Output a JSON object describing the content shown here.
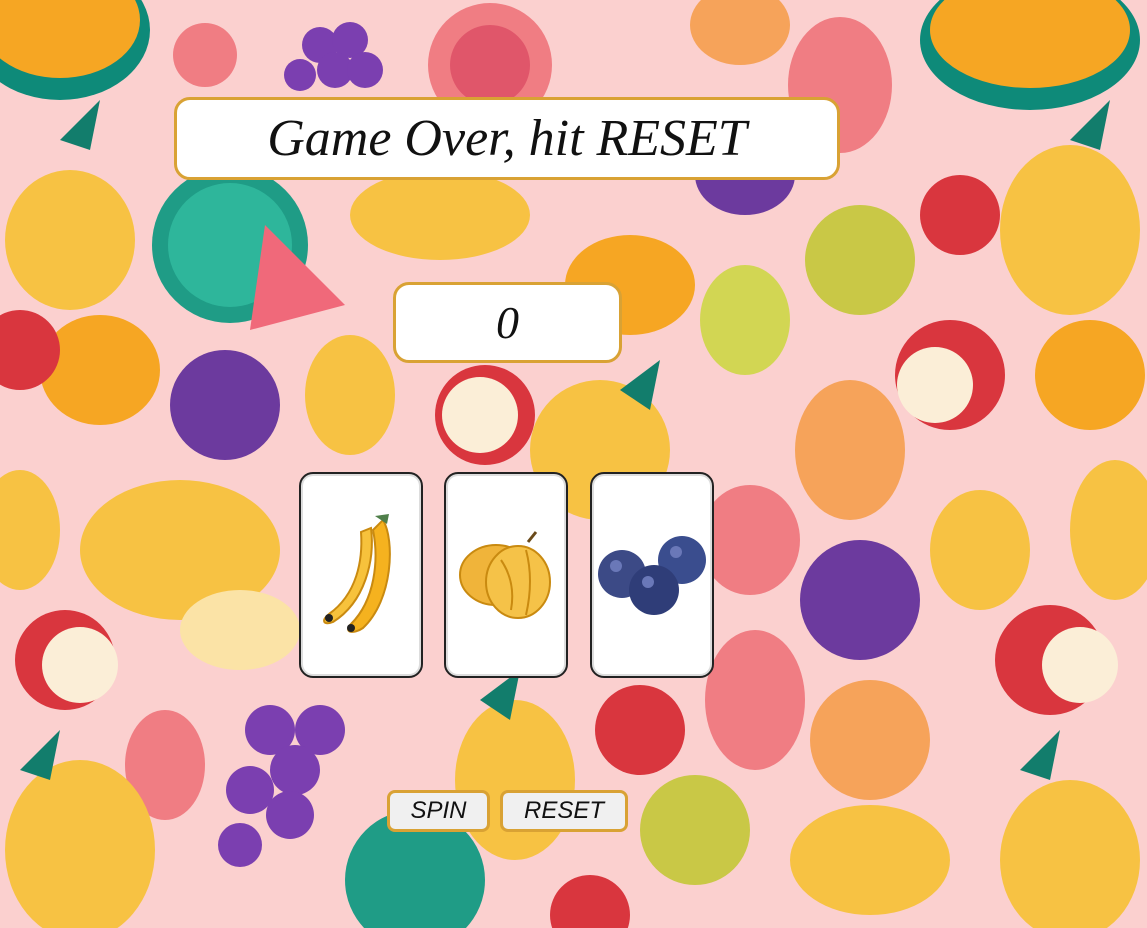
{
  "game": {
    "message": "Game Over, hit RESET",
    "score": "0"
  },
  "reels": [
    {
      "symbol": "banana-icon"
    },
    {
      "symbol": "starfruit-icon"
    },
    {
      "symbol": "blueberries-icon"
    }
  ],
  "controls": {
    "spin_label": "SPIN",
    "reset_label": "RESET"
  },
  "colors": {
    "background": "#fbd0cf",
    "panel_border": "#d9a234",
    "button_fill": "#f0f0f0"
  }
}
